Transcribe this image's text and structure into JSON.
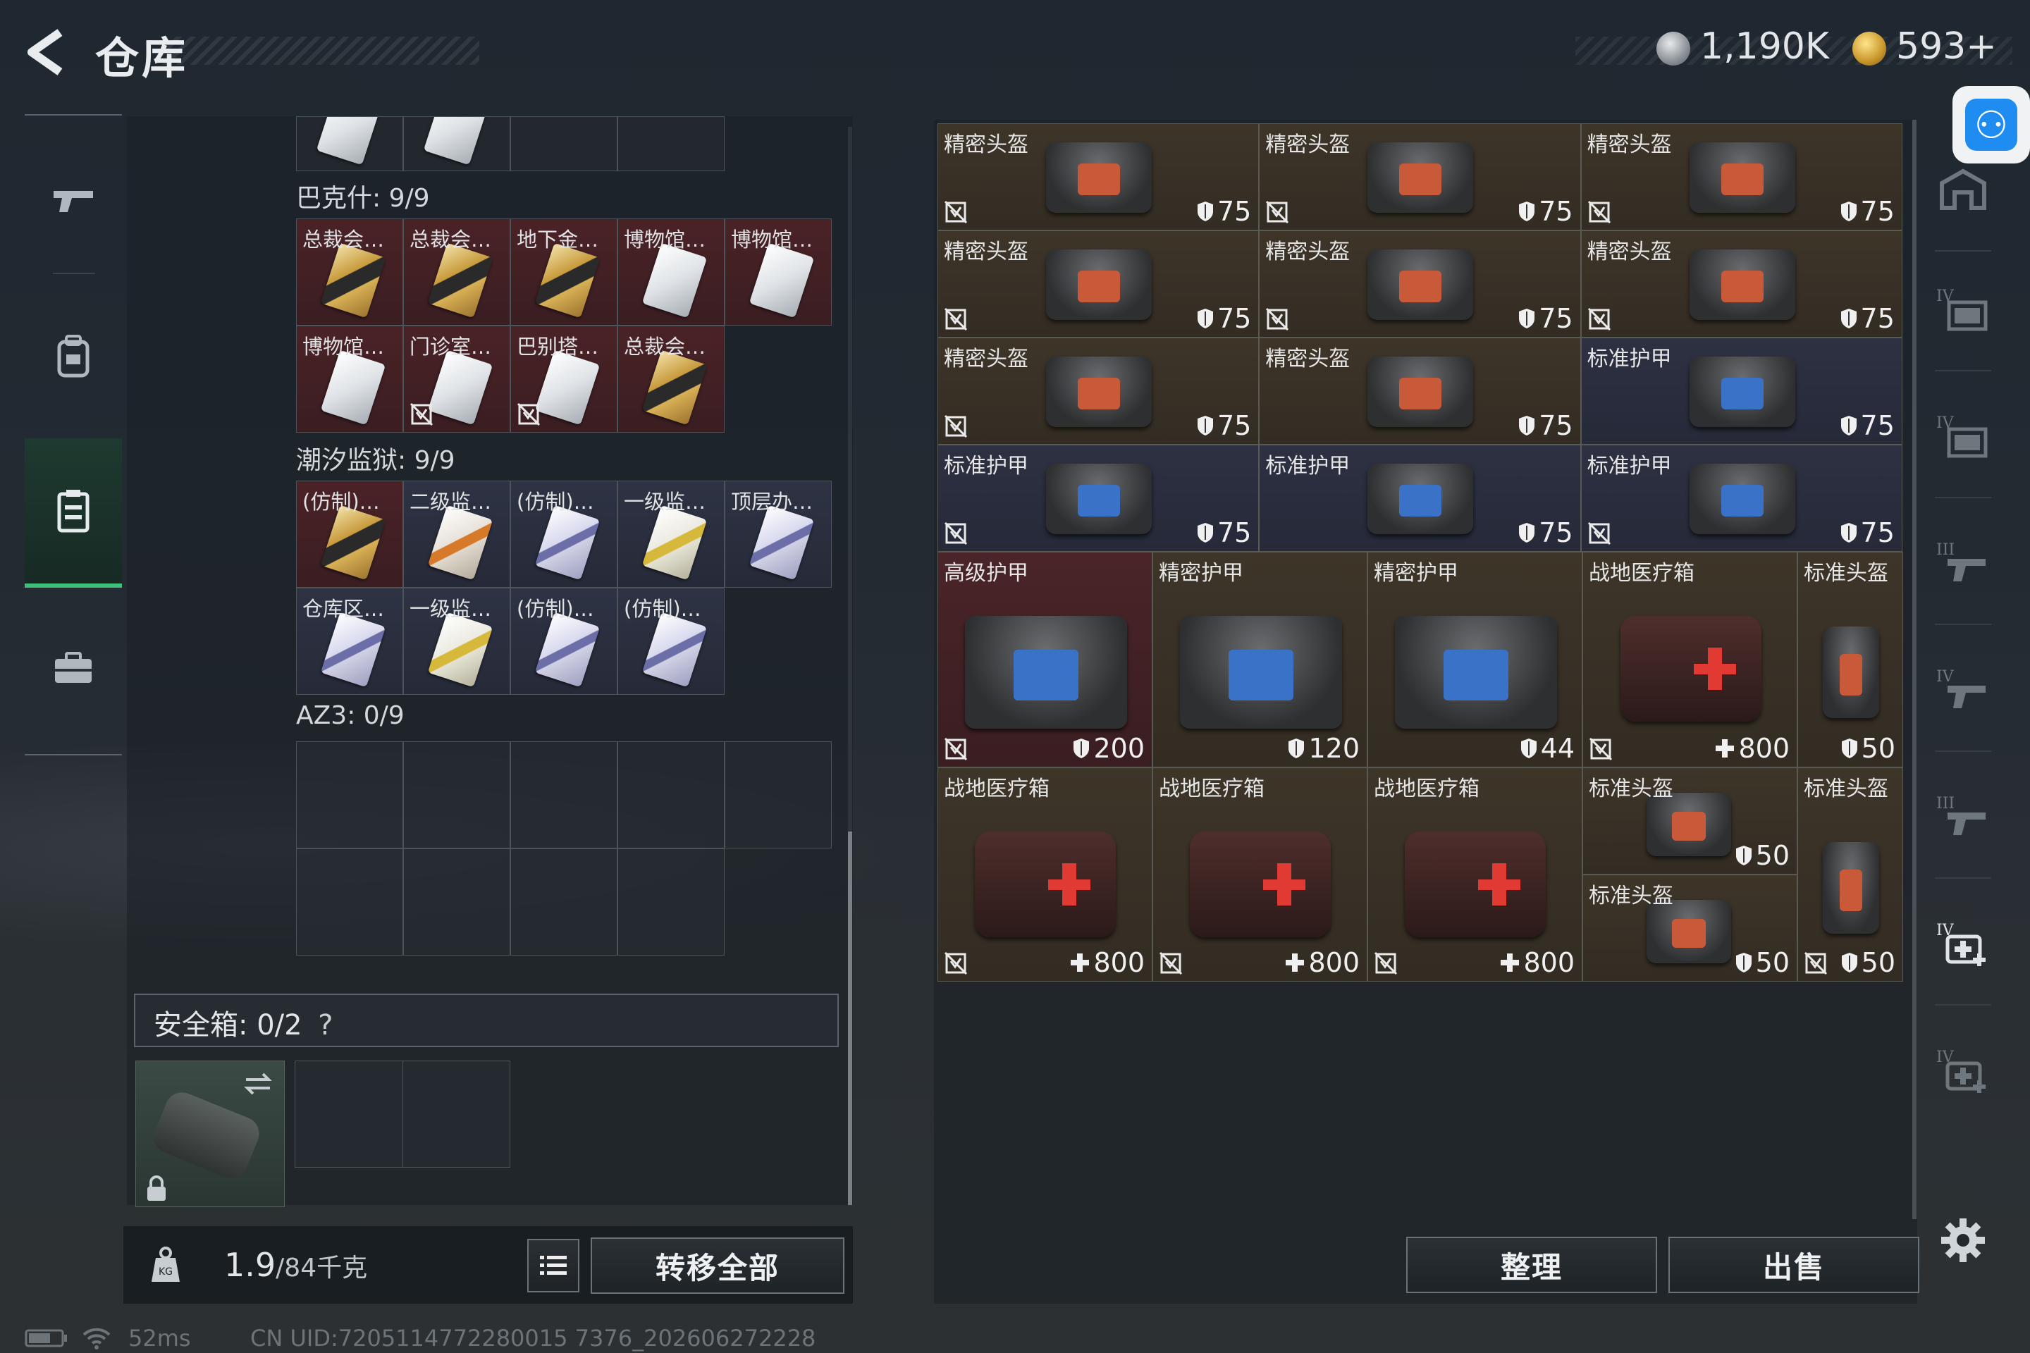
{
  "header": {
    "title": "仓库",
    "currency_1": "1,190K",
    "currency_2": "593+"
  },
  "left_nav": [
    "gun-icon",
    "backpack-icon",
    "rig-icon",
    "toolbox-icon"
  ],
  "sections": {
    "s0_top_row_count": 4,
    "bakeshi": {
      "label": "巴克什: 9/9",
      "items": [
        {
          "label": "总裁会…",
          "card": "gold",
          "bg": "red",
          "nosell": false
        },
        {
          "label": "总裁会…",
          "card": "gold",
          "bg": "red",
          "nosell": false
        },
        {
          "label": "地下金…",
          "card": "gold",
          "bg": "red",
          "nosell": false
        },
        {
          "label": "博物馆…",
          "card": "silver",
          "bg": "red",
          "nosell": false
        },
        {
          "label": "博物馆…",
          "card": "silver",
          "bg": "red",
          "nosell": false
        },
        {
          "label": "博物馆…",
          "card": "silver",
          "bg": "red",
          "nosell": false
        },
        {
          "label": "门诊室…",
          "card": "silver",
          "bg": "red",
          "nosell": true
        },
        {
          "label": "巴别塔…",
          "card": "silver",
          "bg": "red",
          "nosell": true
        },
        {
          "label": "总裁会…",
          "card": "gold",
          "bg": "red",
          "nosell": false
        }
      ]
    },
    "chaoxi": {
      "label": "潮汐监狱: 9/9",
      "items": [
        {
          "label": "(仿制)…",
          "card": "gold",
          "bg": "red"
        },
        {
          "label": "二级监…",
          "card": "orange",
          "bg": "blue"
        },
        {
          "label": "(仿制)…",
          "card": "purple",
          "bg": "blue"
        },
        {
          "label": "一级监…",
          "card": "yellow",
          "bg": "blue"
        },
        {
          "label": "顶层办…",
          "card": "purple",
          "bg": "blue"
        },
        {
          "label": "仓库区…",
          "card": "purple",
          "bg": "blue"
        },
        {
          "label": "一级监…",
          "card": "yellow",
          "bg": "blue"
        },
        {
          "label": "(仿制)…",
          "card": "purple",
          "bg": "blue"
        },
        {
          "label": "(仿制)…",
          "card": "purple",
          "bg": "blue"
        }
      ]
    },
    "az3": {
      "label": "AZ3: 0/9"
    },
    "safe": {
      "label": "安全箱: 0/2",
      "help": "?"
    }
  },
  "bottom_left": {
    "weight_value": "1.9",
    "weight_max": "/84千克",
    "transfer_all": "转移全部"
  },
  "status": {
    "ping": "52ms",
    "uid": "CN UID:7205114772280015 7376_202606272228"
  },
  "stash": {
    "small_items": [
      {
        "name": "精密头盔",
        "type": "helmet",
        "bg": "brown",
        "dur": "75"
      },
      {
        "name": "精密头盔",
        "type": "helmet",
        "bg": "brown",
        "dur": "75"
      },
      {
        "name": "精密头盔",
        "type": "helmet",
        "bg": "brown",
        "dur": "75"
      },
      {
        "name": "精密头盔",
        "type": "helmet",
        "bg": "brown",
        "dur": "75"
      },
      {
        "name": "精密头盔",
        "type": "helmet",
        "bg": "brown",
        "dur": "75"
      },
      {
        "name": "精密头盔",
        "type": "helmet",
        "bg": "brown",
        "dur": "75"
      },
      {
        "name": "精密头盔",
        "type": "helmet",
        "bg": "brown",
        "dur": "75"
      },
      {
        "name": "精密头盔",
        "type": "helmet",
        "bg": "brown",
        "dur": "75"
      },
      {
        "name": "标准护甲",
        "type": "armor",
        "bg": "navy",
        "dur": "75"
      },
      {
        "name": "标准护甲",
        "type": "armor",
        "bg": "navy",
        "dur": "75"
      },
      {
        "name": "标准护甲",
        "type": "armor",
        "bg": "navy",
        "dur": "75"
      },
      {
        "name": "标准护甲",
        "type": "armor",
        "bg": "navy",
        "dur": "75"
      }
    ],
    "row5": [
      {
        "name": "高级护甲",
        "type": "armor",
        "bg": "maroon",
        "dur": "200",
        "nosell": true
      },
      {
        "name": "精密护甲",
        "type": "armor",
        "bg": "brown",
        "dur": "120",
        "nosell": false
      },
      {
        "name": "精密护甲",
        "type": "armor",
        "bg": "brown",
        "dur": "44",
        "nosell": false
      },
      {
        "name": "战地医疗箱",
        "type": "medkit",
        "bg": "brown",
        "dur": "800",
        "nosell": true
      },
      {
        "name": "标准头盔",
        "type": "helmet",
        "bg": "brown",
        "dur": "50",
        "nosell": false
      }
    ],
    "row6": [
      {
        "name": "战地医疗箱",
        "type": "medkit",
        "bg": "brown",
        "dur": "800",
        "nosell": true
      },
      {
        "name": "战地医疗箱",
        "type": "medkit",
        "bg": "brown",
        "dur": "800",
        "nosell": true
      },
      {
        "name": "战地医疗箱",
        "type": "medkit",
        "bg": "brown",
        "dur": "800",
        "nosell": true
      }
    ],
    "small_helmets": [
      {
        "name": "标准头盔",
        "dur": "50"
      },
      {
        "name": "标准头盔",
        "dur": "50"
      }
    ],
    "tall_helmet": {
      "name": "标准头盔",
      "dur": "50"
    }
  },
  "bottom_right": {
    "sort": "整理",
    "sell": "出售"
  },
  "right_nav": [
    "home-icon",
    "folder-iv-icon",
    "folder-iv-icon",
    "gun-iii-icon",
    "gun-iv-icon",
    "gun-iii-icon",
    "medkit-iv-icon",
    "medkit-iv-icon"
  ],
  "colors": {
    "accent_green": "#3fbf7a",
    "item_brown": "#3e3529",
    "item_navy": "#2d3142",
    "item_maroon": "#4a2428"
  }
}
